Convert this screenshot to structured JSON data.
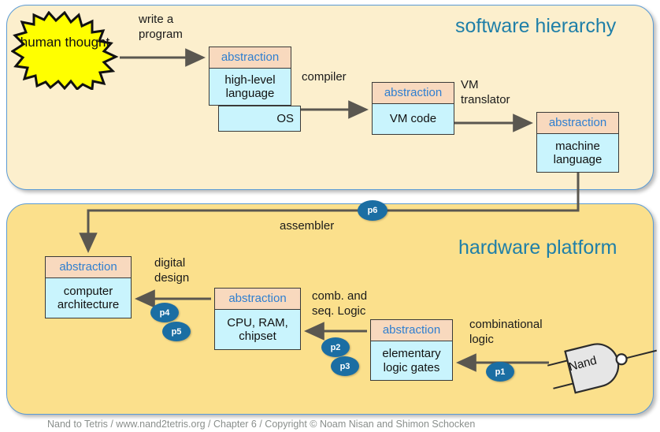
{
  "diagram": {
    "title_internal": "Nand to Tetris course roadmap",
    "panels": {
      "software": {
        "title": "software hierarchy",
        "fill": "#fcefcd",
        "border": "#5b9bd5"
      },
      "hardware": {
        "title": "hardware platform",
        "fill": "#fbe08c",
        "border": "#5b9bd5"
      }
    },
    "starburst": {
      "label": "human\nthought",
      "fill": "#ffff00",
      "stroke": "#000000"
    },
    "boxes": [
      {
        "id": "hll",
        "head": "abstraction",
        "body": "high-level\nlanguage"
      },
      {
        "id": "os",
        "head": "",
        "body": "OS"
      },
      {
        "id": "vm",
        "head": "abstraction",
        "body": "VM code"
      },
      {
        "id": "ml",
        "head": "abstraction",
        "body": "machine\nlanguage"
      },
      {
        "id": "arch",
        "head": "abstraction",
        "body": "computer\narchitecture"
      },
      {
        "id": "cpu",
        "head": "abstraction",
        "body": "CPU, RAM,\nchipset"
      },
      {
        "id": "gates",
        "head": "abstraction",
        "body": "elementary\nlogic gates"
      }
    ],
    "box_colors": {
      "head_fill": "#f8d9be",
      "head_text": "#2f7fd0",
      "body_fill": "#c9f4fd",
      "body_text": "#111111",
      "stroke": "#3a3a38"
    },
    "edge_labels": {
      "write_a_program": "write a\nprogram",
      "compiler": "compiler",
      "vm_translator": "VM\ntranslator",
      "assembler": "assembler",
      "digital_design": "digital\ndesign",
      "comb_and_seq_logic": "comb. and\nseq. Logic",
      "combinational_logic": "combinational\nlogic"
    },
    "project_badges": [
      {
        "id": "p1",
        "label": "p1"
      },
      {
        "id": "p2",
        "label": "p2"
      },
      {
        "id": "p3",
        "label": "p3"
      },
      {
        "id": "p4",
        "label": "p4"
      },
      {
        "id": "p5",
        "label": "p5"
      },
      {
        "id": "p6",
        "label": "p6"
      }
    ],
    "badge_colors": {
      "fill": "#1b6ea3",
      "text": "#ffffff"
    },
    "nand_gate": {
      "label": "Nand",
      "fill": "#e6e6e6",
      "stroke": "#2b2b2b"
    },
    "arrow_color": "#5a5750",
    "footer": "Nand to Tetris / www.nand2tetris.org / Chapter 6 / Copyright © Noam Nisan and Shimon Schocken"
  }
}
